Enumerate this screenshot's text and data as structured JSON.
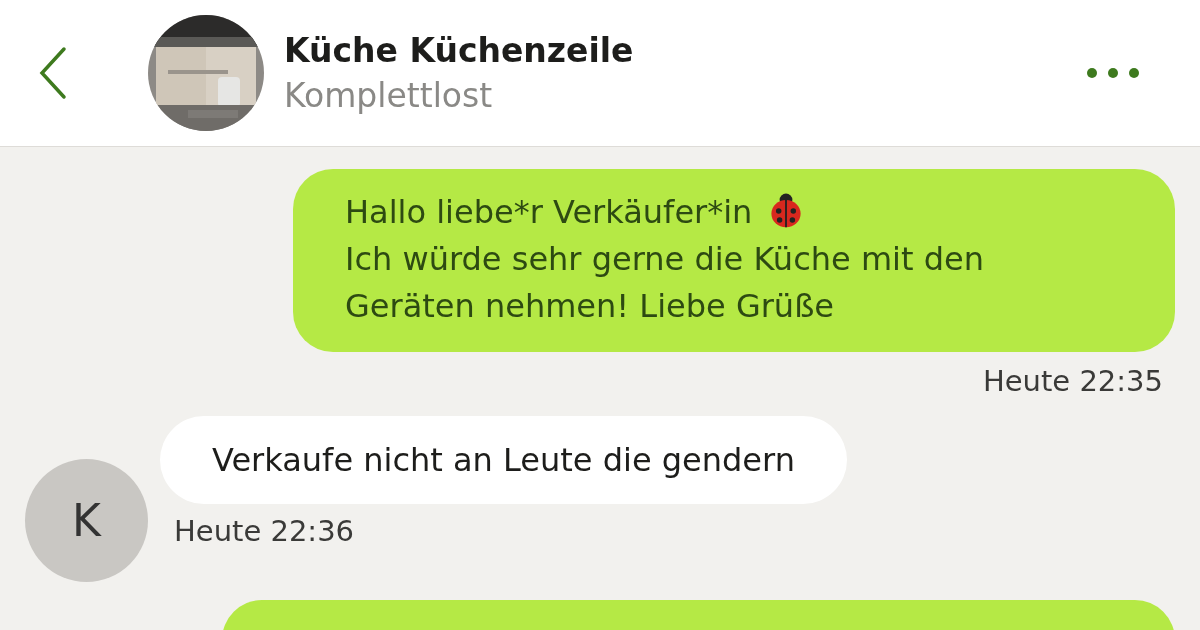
{
  "header": {
    "title": "Küche Küchenzeile",
    "subtitle": "Komplettlost"
  },
  "messages": [
    {
      "kind": "outgoing",
      "text": "Hallo liebe*r Verkäufer*in\nIch würde sehr gerne die Küche mit den\nGeräten nehmen! Liebe Grüße",
      "time": "Heute 22:35"
    },
    {
      "kind": "incoming",
      "sender_initial": "K",
      "text": "Verkaufe nicht an Leute die gendern",
      "time": "Heute 22:36"
    },
    {
      "kind": "outgoing"
    }
  ]
}
